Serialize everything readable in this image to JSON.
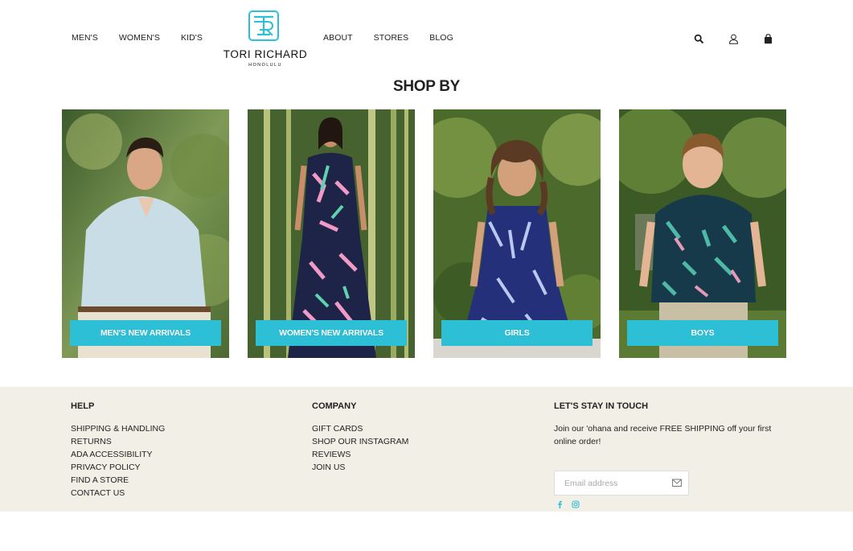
{
  "header": {
    "nav_left": [
      "MEN'S",
      "WOMEN'S",
      "KID'S"
    ],
    "nav_right": [
      "ABOUT",
      "STORES",
      "BLOG"
    ],
    "logo": {
      "name": "TORI RICHARD",
      "city": "HONOLULU"
    },
    "icons": [
      "search-icon",
      "account-icon",
      "cart-bag-icon"
    ]
  },
  "shop": {
    "title": "SHOP BY",
    "tiles": [
      {
        "label": "MEN'S NEW ARRIVALS"
      },
      {
        "label": "WOMEN'S NEW ARRIVALS"
      },
      {
        "label": "GIRLS"
      },
      {
        "label": "BOYS"
      }
    ],
    "cta_color": "#2cbfd6"
  },
  "footer": {
    "background": "#f2f0e6",
    "help": {
      "title": "HELP",
      "links": [
        "SHIPPING & HANDLING",
        "RETURNS",
        "ADA ACCESSIBILITY",
        "PRIVACY POLICY",
        "FIND A STORE",
        "CONTACT US"
      ]
    },
    "company": {
      "title": "COMPANY",
      "links": [
        "GIFT CARDS",
        "SHOP OUR INSTAGRAM",
        "REVIEWS",
        "JOIN US"
      ]
    },
    "newsletter": {
      "title": "LET'S STAY IN TOUCH",
      "text": "Join our 'ohana and receive FREE SHIPPING off your first online order!",
      "email_placeholder": "Email address",
      "email_value": ""
    },
    "socials": [
      "facebook-icon",
      "instagram-icon"
    ],
    "accent_color": "#2cbfd6"
  }
}
